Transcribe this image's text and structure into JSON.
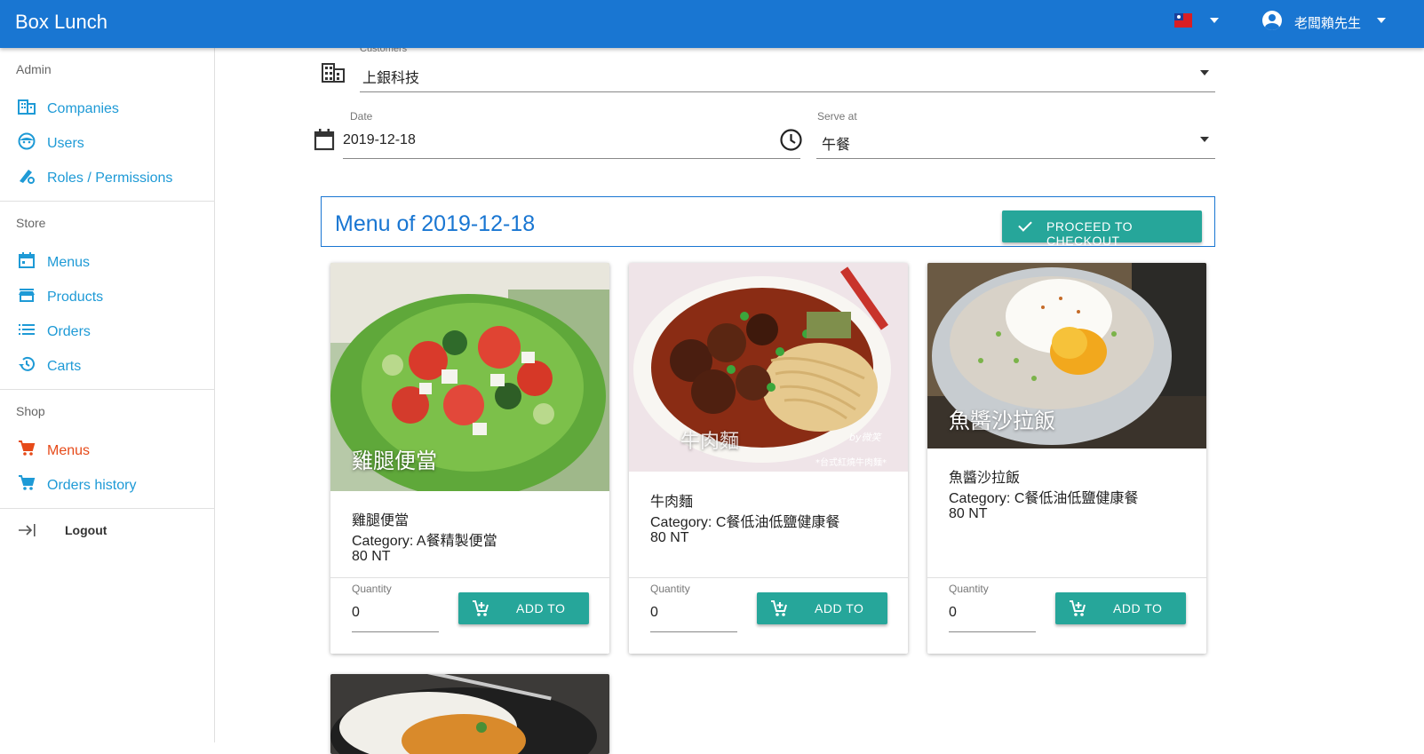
{
  "app": {
    "title": "Box Lunch",
    "user_name": "老闆賴先生"
  },
  "sidebar": {
    "admin_label": "Admin",
    "admin_items": [
      {
        "label": "Companies",
        "icon": "building-icon"
      },
      {
        "label": "Users",
        "icon": "face-icon"
      },
      {
        "label": "Roles / Permissions",
        "icon": "roles-icon"
      }
    ],
    "store_label": "Store",
    "store_items": [
      {
        "label": "Menus",
        "icon": "calendar-icon"
      },
      {
        "label": "Products",
        "icon": "store-icon"
      },
      {
        "label": "Orders",
        "icon": "list-icon"
      },
      {
        "label": "Carts",
        "icon": "history-icon"
      }
    ],
    "shop_label": "Shop",
    "shop_items": [
      {
        "label": "Menus",
        "icon": "cart-icon",
        "active": true
      },
      {
        "label": "Orders history",
        "icon": "cart-icon"
      }
    ],
    "logout_label": "Logout"
  },
  "filters": {
    "customer_label": "Customers",
    "customer_value": "上銀科技",
    "date_label": "Date",
    "date_value": "2019-12-18",
    "serve_label": "Serve at",
    "serve_value": "午餐"
  },
  "menu": {
    "title": "Menu of 2019-12-18",
    "checkout_label": "PROCEED TO CHECKOUT"
  },
  "products": [
    {
      "image_title": "雞腿便當",
      "name": "雞腿便當",
      "category": "Category: A餐精製便當",
      "price": "80 NT",
      "quantity_label": "Quantity",
      "quantity": "0",
      "button_label": "ADD TO"
    },
    {
      "image_title": "牛肉麵",
      "name": "牛肉麵",
      "category": "Category: C餐低油低鹽健康餐",
      "price": "80 NT",
      "quantity_label": "Quantity",
      "quantity": "0",
      "button_label": "ADD TO",
      "image_watermark": "by微笑",
      "image_caption": "*台式紅燒牛肉麵*"
    },
    {
      "image_title": "魚醬沙拉飯",
      "name": "魚醬沙拉飯",
      "category": "Category: C餐低油低鹽健康餐",
      "price": "80 NT",
      "quantity_label": "Quantity",
      "quantity": "0",
      "button_label": "ADD TO"
    }
  ],
  "colors": {
    "appbar": "#1976d2",
    "link": "#1e9ad6",
    "active": "#e64a19",
    "button": "#26a69a"
  }
}
